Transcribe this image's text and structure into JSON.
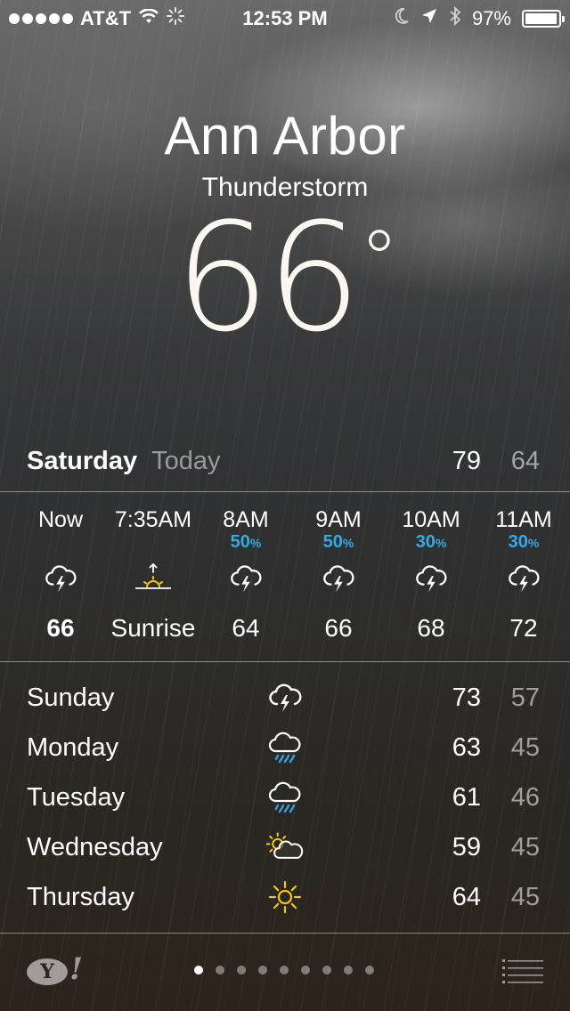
{
  "status_bar": {
    "carrier": "AT&T",
    "time": "12:53 PM",
    "battery_percent": "97%",
    "battery_level": 0.97,
    "signal_bars": 5
  },
  "location": {
    "city": "Ann Arbor",
    "condition": "Thunderstorm",
    "temperature": "66",
    "degree_symbol": "°"
  },
  "today": {
    "day": "Saturday",
    "label": "Today",
    "high": "79",
    "low": "64"
  },
  "hourly": [
    {
      "time": "Now",
      "chance": "",
      "pct": "",
      "icon": "thunderstorm-icon",
      "temp": "66",
      "bold": true
    },
    {
      "time": "7:35AM",
      "chance": "",
      "pct": "",
      "icon": "sunrise-icon",
      "temp": "Sunrise",
      "bold": false
    },
    {
      "time": "8AM",
      "chance": "50",
      "pct": "%",
      "icon": "thunderstorm-icon",
      "temp": "64",
      "bold": false
    },
    {
      "time": "9AM",
      "chance": "50",
      "pct": "%",
      "icon": "thunderstorm-icon",
      "temp": "66",
      "bold": false
    },
    {
      "time": "10AM",
      "chance": "30",
      "pct": "%",
      "icon": "thunderstorm-icon",
      "temp": "68",
      "bold": false
    },
    {
      "time": "11AM",
      "chance": "30",
      "pct": "%",
      "icon": "thunderstorm-icon",
      "temp": "72",
      "bold": false
    }
  ],
  "daily": [
    {
      "day": "Sunday",
      "icon": "thunderstorm-icon",
      "high": "73",
      "low": "57"
    },
    {
      "day": "Monday",
      "icon": "rain-icon",
      "high": "63",
      "low": "45"
    },
    {
      "day": "Tuesday",
      "icon": "rain-icon",
      "high": "61",
      "low": "46"
    },
    {
      "day": "Wednesday",
      "icon": "partly-cloudy-icon",
      "high": "59",
      "low": "45"
    },
    {
      "day": "Thursday",
      "icon": "sunny-icon",
      "high": "64",
      "low": "45"
    }
  ],
  "footer": {
    "logo_text": "Y!",
    "page_count": 9,
    "active_page": 0
  },
  "colors": {
    "precip_blue": "#35a9e6",
    "sun_yellow": "#f5c518",
    "rain_blue": "#3aa0dc"
  }
}
